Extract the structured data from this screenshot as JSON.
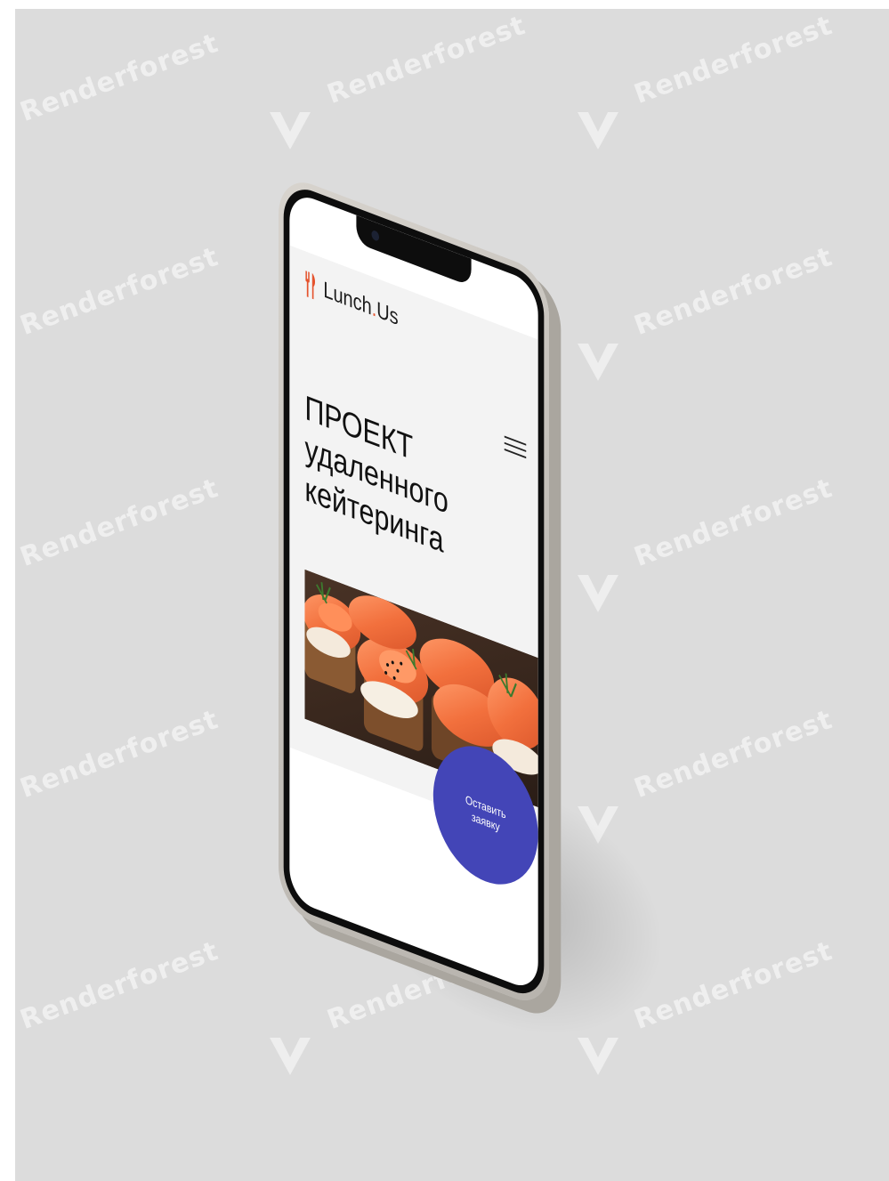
{
  "watermark": {
    "text": "Renderforest"
  },
  "app": {
    "brand_name": "Lunch",
    "brand_dot": ".",
    "brand_suffix": "Us",
    "logo_icon": "fork-and-knife-icon",
    "menu_icon": "hamburger-menu-icon"
  },
  "hero": {
    "headline_line1": "ПРОЕКТ",
    "headline_line2": "удаленного",
    "headline_line3": "кейтеринга",
    "image": "salmon-canapes-photo"
  },
  "cta": {
    "label": "Оставить заявку"
  },
  "colors": {
    "accent": "#e5532d",
    "cta_background": "#4345b7",
    "hero_background": "#f3f3f3",
    "backdrop": "#dcdcdc",
    "phone_frame": "#c9c5bf"
  }
}
